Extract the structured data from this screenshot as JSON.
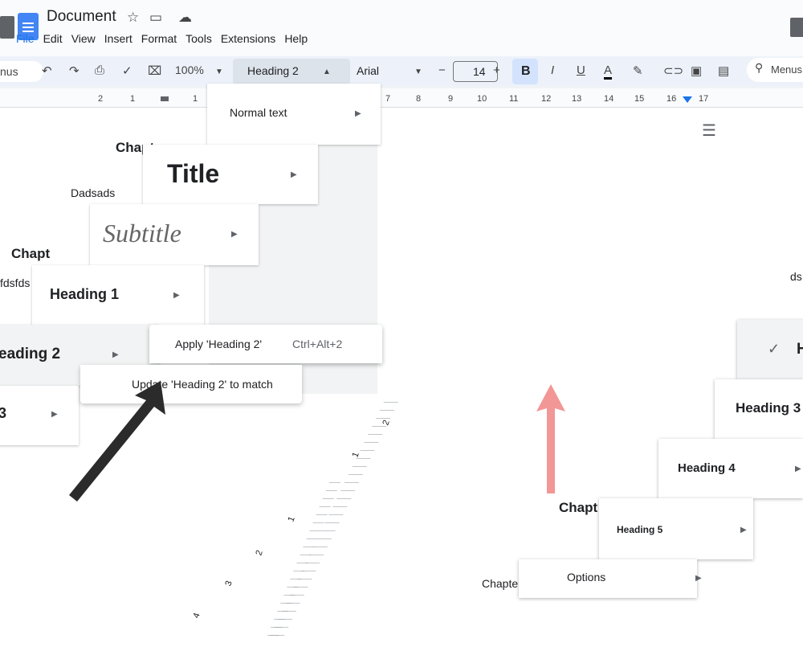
{
  "app": {
    "doc_title": "Document",
    "title_icons": [
      "star-icon",
      "move-to-folder-icon",
      "cloud-status-icon"
    ]
  },
  "menubar": [
    "File",
    "Edit",
    "View",
    "Insert",
    "Format",
    "Tools",
    "Extensions",
    "Help"
  ],
  "toolbar": {
    "menus_label": "nus",
    "zoom": "100%",
    "style": "Heading 2",
    "font": "Arial",
    "font_size": "14",
    "bold": "B",
    "italic": "I",
    "underline": "U",
    "text_color": "A",
    "search_label": "Menus",
    "icons": [
      "undo-icon",
      "redo-icon",
      "print-icon",
      "spellcheck-icon",
      "paint-format-icon",
      "pen-icon",
      "link-icon",
      "comment-icon",
      "image-icon"
    ]
  },
  "ruler": [
    "2",
    "1",
    "1",
    "7",
    "8",
    "9",
    "10",
    "11",
    "12",
    "13",
    "14",
    "15",
    "16",
    "17"
  ],
  "document": {
    "chapter_1": "Chapt",
    "text_1": "Dadsads",
    "chapter_2": "Chapt",
    "text_2": "fdsfds",
    "chapter_3": "Chapt",
    "chapter_4": "Chapter",
    "text_3": "ds"
  },
  "styles_menu": {
    "normal": "Normal text",
    "title": "Title",
    "subtitle": "Subtitle",
    "heading1": "Heading 1",
    "heading2": "eading 2",
    "heading3": "3"
  },
  "submenu": {
    "apply": "Apply 'Heading 2'",
    "apply_shortcut": "Ctrl+Alt+2",
    "update": "Update 'Heading 2' to match"
  },
  "right_menu": {
    "heading2_partial": "H",
    "heading3_partial": "Heading 3",
    "heading4": "Heading 4",
    "heading5": "Heading 5",
    "options": "Options"
  },
  "vertical_ruler": [
    "2",
    "1",
    "1",
    "2",
    "3",
    "4"
  ],
  "colors": {
    "accent": "#1a73e8",
    "toolbar_bg": "#edf2fa",
    "arrow_pink": "#f28b8b",
    "arrow_black": "#2b2b2b"
  }
}
